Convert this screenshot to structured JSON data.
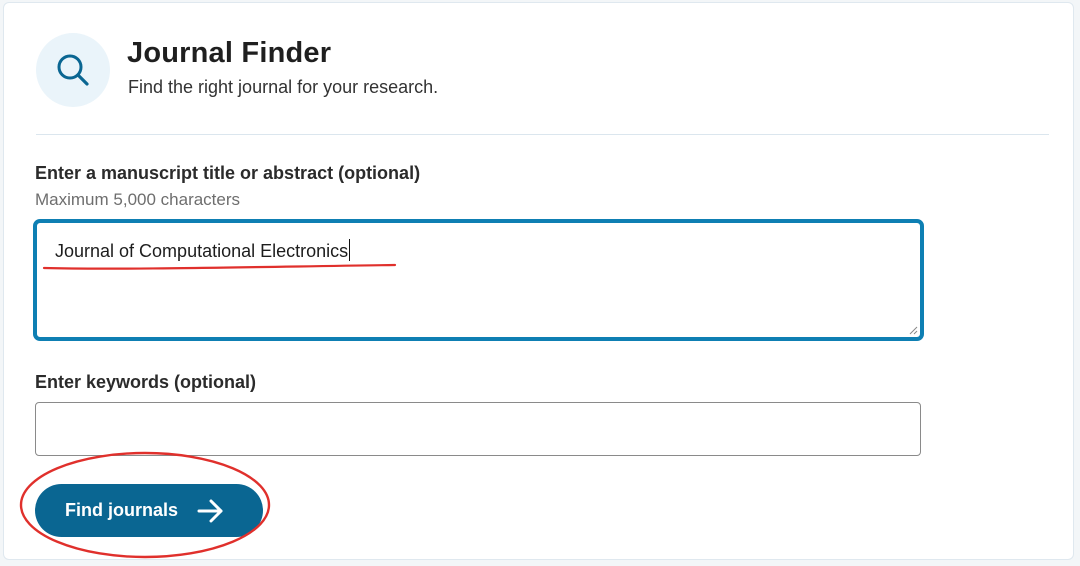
{
  "header": {
    "icon": "search-icon",
    "title": "Journal Finder",
    "subtitle": "Find the right journal for your research."
  },
  "manuscript": {
    "label": "Enter a manuscript title or abstract (optional)",
    "hint": "Maximum 5,000 characters",
    "value": "Journal of Computational Electronics"
  },
  "keywords": {
    "label": "Enter keywords (optional)",
    "value": ""
  },
  "actions": {
    "find_label": "Find journals",
    "find_icon": "arrow-right-icon"
  },
  "colors": {
    "brand": "#0a6692",
    "focus_border": "#0e7fb3",
    "annotation": "#e0302c"
  }
}
